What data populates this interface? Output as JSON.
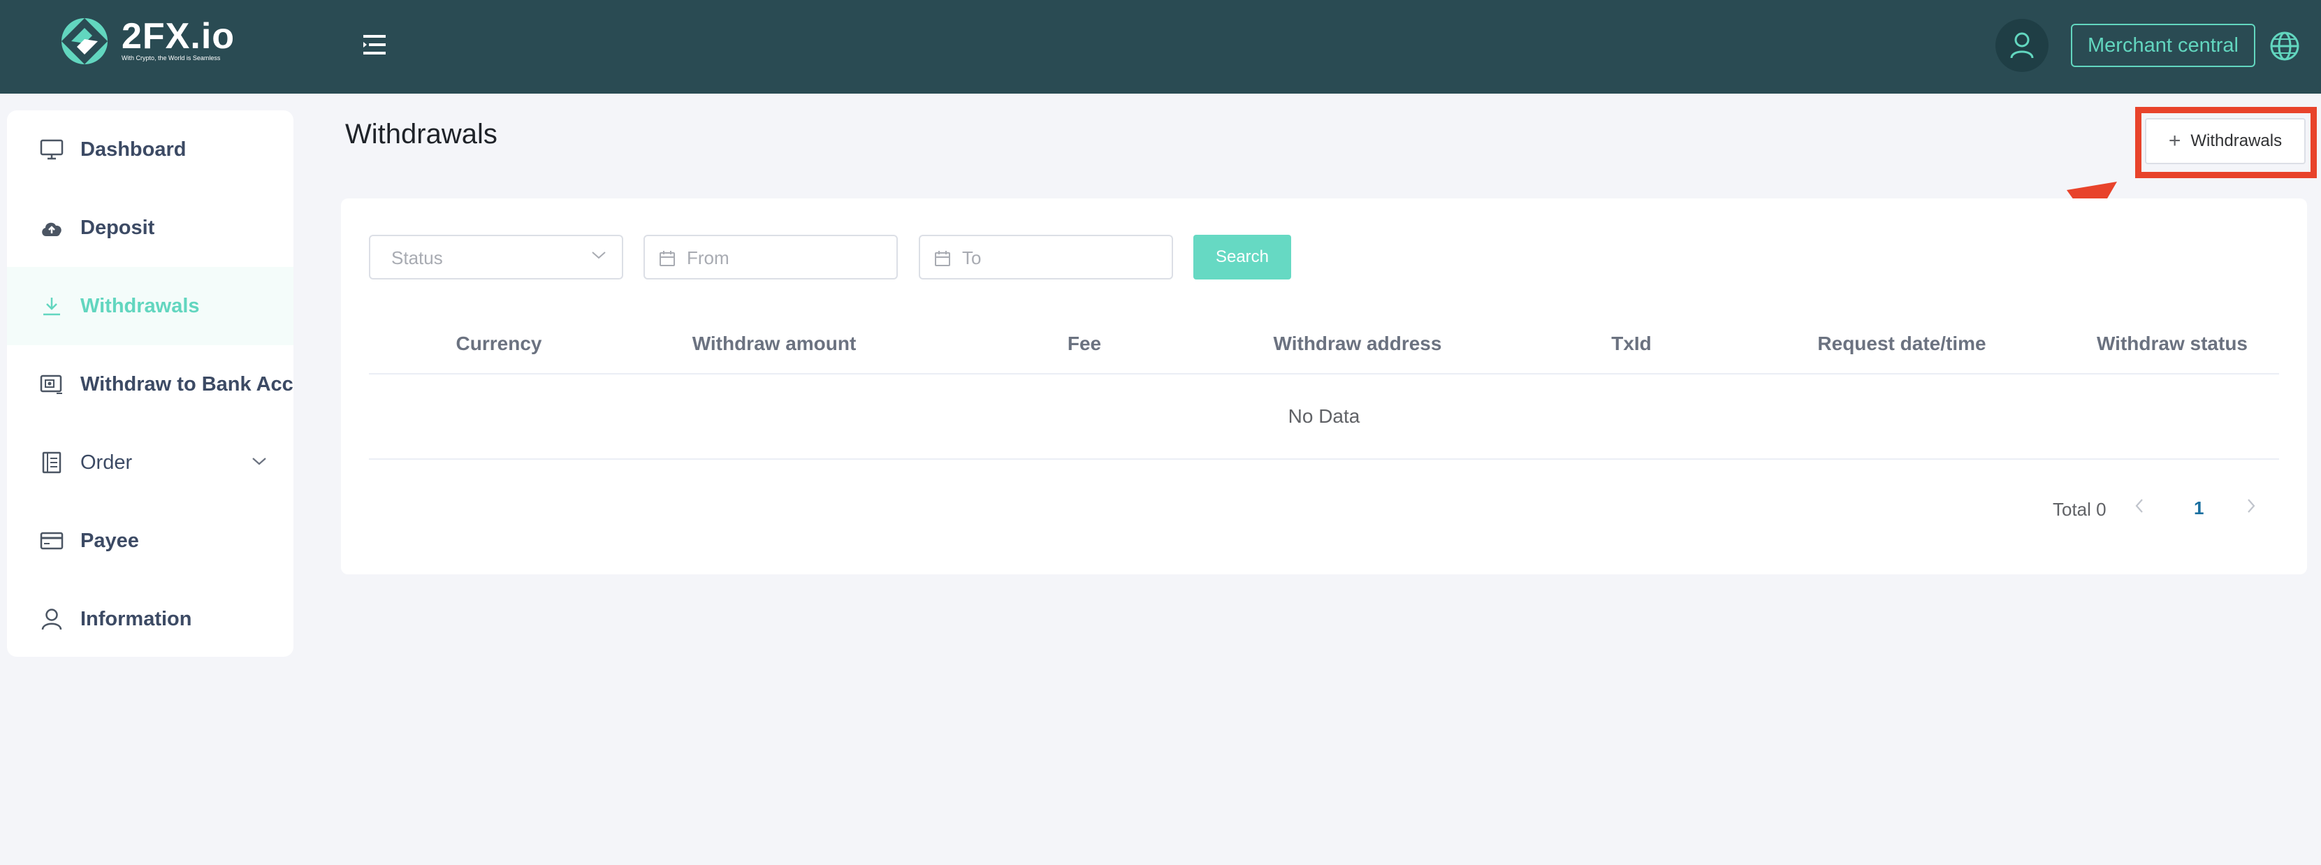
{
  "brand": {
    "name": "2FX.io",
    "tagline": "With Crypto, the World is Seamless"
  },
  "header": {
    "merchant_label": "Merchant central",
    "icons": [
      "menu-icon",
      "user-icon",
      "globe-icon"
    ]
  },
  "sidebar": {
    "items": [
      {
        "label": "Dashboard",
        "icon": "monitor-icon"
      },
      {
        "label": "Deposit",
        "icon": "cloud-upload-icon"
      },
      {
        "label": "Withdrawals",
        "icon": "download-icon",
        "active": true
      },
      {
        "label": "Withdraw to Bank Account",
        "icon": "bank-card-icon"
      },
      {
        "label": "Order",
        "icon": "document-icon",
        "expandable": true
      },
      {
        "label": "Payee",
        "icon": "credit-card-icon"
      },
      {
        "label": "Information",
        "icon": "person-icon"
      }
    ]
  },
  "main": {
    "title": "Withdrawals",
    "add_button_label": "Withdrawals",
    "filters": {
      "status_placeholder": "Status",
      "from_placeholder": "From",
      "to_placeholder": "To",
      "search_label": "Search"
    },
    "table": {
      "columns": [
        "Currency",
        "Withdraw amount",
        "Fee",
        "Withdraw address",
        "TxId",
        "Request date/time",
        "Withdraw status"
      ],
      "empty_text": "No Data"
    },
    "pagination": {
      "total_label": "Total 0",
      "current_page": "1"
    }
  },
  "colors": {
    "header_bg": "#2a4b53",
    "accent": "#62d6bf",
    "highlight": "#e8432b"
  }
}
